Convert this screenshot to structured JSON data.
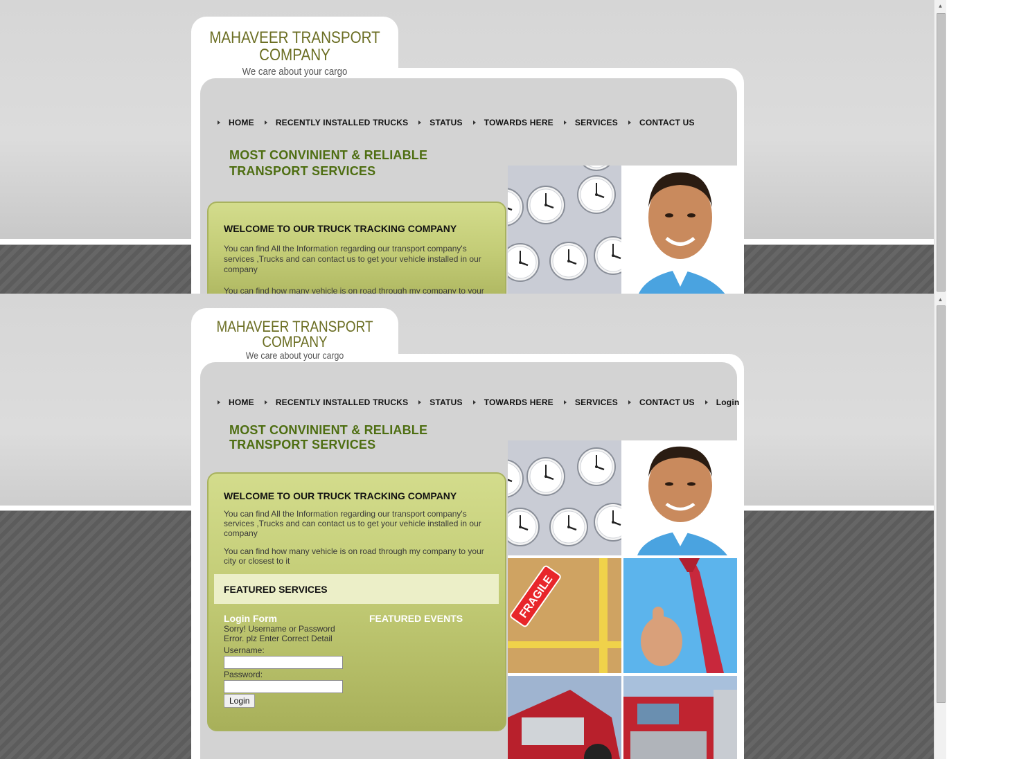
{
  "brand": {
    "title_line1": "MAHAVEER TRANSPORT",
    "title_line2": "COMPANY",
    "tagline": "We care about your cargo"
  },
  "nav_top": [
    "HOME",
    "RECENTLY INSTALLED TRUCKS",
    "STATUS",
    "TOWARDS HERE",
    "SERVICES",
    "CONTACT US"
  ],
  "nav_bottom": [
    "HOME",
    "RECENTLY INSTALLED TRUCKS",
    "STATUS",
    "TOWARDS HERE",
    "SERVICES",
    "CONTACT US",
    "Login"
  ],
  "headline": {
    "line1": "MOST CONVINIENT & RELIABLE",
    "line2": "TRANSPORT SERVICES"
  },
  "welcome": {
    "title": "WELCOME TO OUR TRUCK TRACKING COMPANY",
    "para1": "You can find All the Information regarding our transport company's services ,Trucks and can contact us to get your vehicle installed in our company",
    "para2": "You can find how many vehicle is on road through my company to your city or closest to it"
  },
  "featured_services": "FEATURED SERVICES",
  "featured_events": "FEATURED EVENTS",
  "login_form": {
    "title": "Login Form",
    "error": "Sorry! Username or Password Error. plz Enter Correct Detail",
    "username_label": "Username:",
    "password_label": "Password:",
    "username_value": "",
    "password_value": "",
    "button_label": "Login"
  },
  "photos": [
    "wall-clocks",
    "smiling-man",
    "fragile-box",
    "thumbs-up-man",
    "red-truck",
    "red-truck-front"
  ],
  "sticker_text": "FRAGILE",
  "colors": {
    "headline": "#4e6e12",
    "logo": "#6b6e23",
    "panel": "#c3cc76"
  }
}
